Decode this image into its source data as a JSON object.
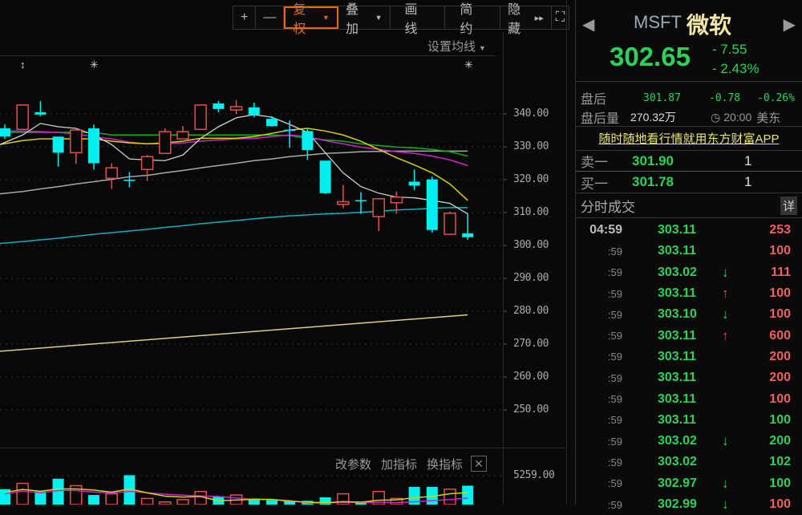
{
  "toolbar": {
    "zoom_in": "+",
    "zoom_out": "—",
    "adjust": "复权",
    "overlay": "叠加",
    "draw": "画线",
    "simple": "简约",
    "hide": "隐藏",
    "hide_icon": "▸▸",
    "fullscreen_icon": "⛶"
  },
  "ma_setting": "设置均线",
  "markers": [
    "↕",
    "✳",
    "✳"
  ],
  "price_axis": [
    "340.00",
    "330.00",
    "320.00",
    "310.00",
    "300.00",
    "290.00",
    "280.00",
    "270.00",
    "260.00",
    "250.00"
  ],
  "volume": {
    "axis_label": "5259.00",
    "change_params": "改参数",
    "add_indicator": "加指标",
    "swap_indicator": "换指标",
    "close": "✕"
  },
  "colors": {
    "up": "#e05050",
    "down": "#00f0f0",
    "ma5": "#d0d0d0",
    "ma10": "#d8d000",
    "ma20": "#d020d0",
    "ma30": "#10b010",
    "ma60": "#a8a8a8",
    "ma120": "#10b0c0",
    "ma250": "#d8d080"
  },
  "chart_data": {
    "type": "candlestick",
    "ylim": [
      250,
      345
    ],
    "ohlc": [
      [
        335.6,
        336.8,
        332.4,
        333.1
      ],
      [
        335.3,
        342.9,
        335.3,
        342.7
      ],
      [
        340.5,
        343.9,
        339.3,
        339.8
      ],
      [
        333.1,
        333.1,
        324.0,
        328.2
      ],
      [
        328.2,
        335.6,
        324.8,
        335.1
      ],
      [
        335.6,
        336.8,
        323.1,
        325.0
      ],
      [
        320.4,
        325.0,
        317.2,
        323.6
      ],
      [
        320.0,
        322.3,
        317.7,
        319.9
      ],
      [
        323.1,
        327.5,
        319.6,
        327.0
      ],
      [
        328.0,
        335.6,
        328.0,
        334.6
      ],
      [
        332.4,
        336.3,
        332.4,
        334.6
      ],
      [
        335.3,
        342.9,
        335.3,
        342.7
      ],
      [
        343.2,
        343.9,
        340.5,
        341.5
      ],
      [
        341.2,
        344.2,
        340.0,
        342.2
      ],
      [
        342.0,
        343.4,
        339.0,
        339.8
      ],
      [
        338.5,
        339.3,
        336.1,
        336.3
      ],
      [
        335.2,
        338.0,
        329.7,
        335.0
      ],
      [
        334.8,
        335.6,
        326.0,
        329.0
      ],
      [
        325.8,
        325.8,
        315.7,
        315.9
      ],
      [
        312.5,
        318.4,
        311.3,
        313.3
      ],
      [
        313.8,
        316.2,
        309.6,
        313.6
      ],
      [
        308.8,
        314.2,
        304.4,
        314.2
      ],
      [
        313.0,
        316.4,
        309.6,
        314.7
      ],
      [
        319.4,
        323.1,
        316.9,
        318.2
      ],
      [
        320.1,
        320.9,
        303.9,
        304.7
      ],
      [
        303.4,
        310.3,
        303.4,
        309.8
      ],
      [
        303.7,
        309.8,
        301.7,
        302.5
      ]
    ],
    "ma": {
      "ma5": [
        330.7,
        333.6,
        337.1,
        336.1,
        335.6,
        333.6,
        330.7,
        326.3,
        326.0,
        325.8,
        327.5,
        332.6,
        336.1,
        338.8,
        339.8,
        339.0,
        336.8,
        334.4,
        328.2,
        322.1,
        317.9,
        315.9,
        314.7,
        314.5,
        313.7,
        312.8,
        309.6
      ],
      "ma10": [
        330.7,
        331.9,
        332.4,
        332.4,
        332.4,
        332.4,
        331.7,
        331.2,
        330.9,
        331.2,
        331.7,
        332.6,
        332.6,
        332.6,
        333.1,
        334.1,
        335.1,
        335.6,
        334.8,
        333.6,
        331.7,
        329.2,
        326.7,
        324.5,
        322.1,
        318.7,
        313.7
      ],
      "ma20": [
        334.8,
        334.8,
        334.6,
        334.4,
        333.9,
        333.1,
        332.4,
        331.4,
        330.9,
        330.9,
        331.2,
        331.7,
        332.1,
        332.4,
        332.6,
        333.1,
        333.6,
        333.1,
        331.9,
        330.9,
        329.9,
        329.2,
        328.5,
        328.0,
        327.2,
        326.0,
        324.3
      ],
      "ma30": [
        334.4,
        334.4,
        334.4,
        334.4,
        334.4,
        334.4,
        333.6,
        333.6,
        333.6,
        333.6,
        333.6,
        333.6,
        333.6,
        333.6,
        333.6,
        333.6,
        333.4,
        332.6,
        332.1,
        331.7,
        330.9,
        330.4,
        329.9,
        329.7,
        329.2,
        328.5,
        327.2
      ],
      "ma60": [
        315.7,
        316.4,
        317.2,
        317.9,
        318.7,
        319.4,
        320.1,
        320.9,
        321.3,
        322.1,
        322.8,
        323.6,
        324.3,
        325.0,
        325.8,
        326.3,
        327.0,
        327.5,
        328.0,
        328.2,
        328.5,
        328.6,
        328.7,
        328.7,
        328.7,
        328.7,
        328.7
      ],
      "ma120": [
        300.6,
        301.2,
        301.7,
        302.2,
        302.8,
        303.4,
        303.9,
        304.4,
        304.9,
        305.5,
        306.0,
        306.6,
        307.1,
        307.6,
        308.1,
        308.6,
        309.0,
        309.3,
        309.6,
        309.8,
        310.1,
        310.4,
        310.8,
        311.0,
        311.3,
        311.5,
        311.5
      ],
      "ma250": [
        267.6,
        268.0,
        268.5,
        268.9,
        269.3,
        269.8,
        270.2,
        270.6,
        271.1,
        271.5,
        271.9,
        272.4,
        272.8,
        273.2,
        273.7,
        274.1,
        274.5,
        275.0,
        275.4,
        275.8,
        276.3,
        276.7,
        277.1,
        277.6,
        278.0,
        278.4,
        278.9
      ]
    },
    "volume_values": [
      4100,
      4600,
      3900,
      5000,
      4400,
      3600,
      3700,
      5300,
      3300,
      3000,
      3200,
      3900,
      3500,
      3600,
      3300,
      3200,
      3100,
      3100,
      3400,
      3700,
      3000,
      3900,
      3300,
      4300,
      4300,
      4100,
      4400
    ]
  },
  "quote": {
    "symbol": "MSFT",
    "name": "微软",
    "price": "302.65",
    "change": "- 7.55",
    "change_pct": "- 2.43%",
    "after_hours_label": "盘后",
    "after_hours_price": "301.87",
    "after_hours_change": "-0.78",
    "after_hours_pct": "-0.26%",
    "after_hours_vol_label": "盘后量",
    "after_hours_vol": "270.32万",
    "time": "20:00",
    "tz": "美东"
  },
  "ad": "随时随地看行情就用东方财富APP",
  "orderbook": [
    {
      "label": "卖一",
      "price": "301.90",
      "vol": "1"
    },
    {
      "label": "买一",
      "price": "301.78",
      "vol": "1"
    }
  ],
  "ticks_title": "分时成交",
  "ticks_detail": "详",
  "ticks": [
    {
      "t": "04:59",
      "p": "303.11",
      "a": "",
      "v": "253",
      "vc": "up"
    },
    {
      "t": ":59",
      "p": "303.11",
      "a": "",
      "v": "100",
      "vc": "up"
    },
    {
      "t": ":59",
      "p": "303.02",
      "a": "↓",
      "v": "111",
      "vc": "up"
    },
    {
      "t": ":59",
      "p": "303.11",
      "a": "↑",
      "v": "100",
      "vc": "up"
    },
    {
      "t": ":59",
      "p": "303.10",
      "a": "↓",
      "v": "100",
      "vc": "up"
    },
    {
      "t": ":59",
      "p": "303.11",
      "a": "↑",
      "v": "600",
      "vc": "up"
    },
    {
      "t": ":59",
      "p": "303.11",
      "a": "",
      "v": "200",
      "vc": "up"
    },
    {
      "t": ":59",
      "p": "303.11",
      "a": "",
      "v": "200",
      "vc": "up"
    },
    {
      "t": ":59",
      "p": "303.11",
      "a": "",
      "v": "100",
      "vc": "up"
    },
    {
      "t": ":59",
      "p": "303.11",
      "a": "",
      "v": "100",
      "vc": "down"
    },
    {
      "t": ":59",
      "p": "303.02",
      "a": "↓",
      "v": "200",
      "vc": "down"
    },
    {
      "t": ":59",
      "p": "303.02",
      "a": "",
      "v": "102",
      "vc": "down"
    },
    {
      "t": ":59",
      "p": "302.97",
      "a": "↓",
      "v": "100",
      "vc": "down"
    },
    {
      "t": ":59",
      "p": "302.99",
      "a": "↓",
      "v": "100",
      "vc": "up"
    }
  ]
}
